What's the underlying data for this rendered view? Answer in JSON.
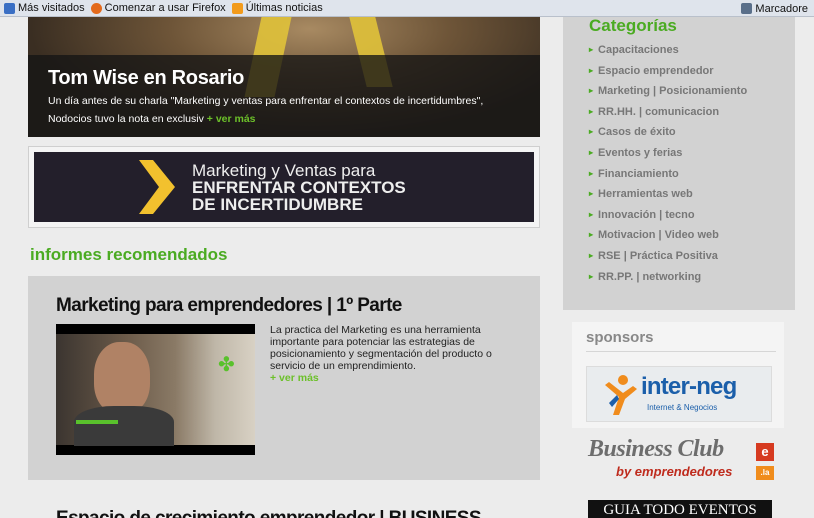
{
  "bookmarks": {
    "items": [
      {
        "label": "Más visitados",
        "icon": "most-visited-icon"
      },
      {
        "label": "Comenzar a usar Firefox",
        "icon": "firefox-icon"
      },
      {
        "label": "Últimas noticias",
        "icon": "rss-icon"
      }
    ],
    "right_label": "Marcadore"
  },
  "hero": {
    "title": "Tom Wise en Rosario",
    "text_line1": "Un día antes de su charla \"Marketing y ventas para enfrentar el contextos de incertidumbres\",",
    "text_line2": "Nodocios tuvo la nota en exclusiv",
    "more_link": "+ ver más"
  },
  "banner": {
    "line1": "Marketing y Ventas para",
    "line2": "ENFRENTAR CONTEXTOS",
    "line3": "DE INCERTIDUMBRE"
  },
  "informes": {
    "section_title": "informes recomendados",
    "article1": {
      "title": "Marketing para emprendedores | 1º Parte",
      "text": "La practica del Marketing es una herramienta importante para potenciar las estrategias de posicionamiento y segmentación del producto o servicio de un emprendimiento.",
      "more_link": "+ ver más"
    },
    "article2": {
      "title": "Espacio de crecimiento emprendedor | BUSINESS"
    }
  },
  "sidebar": {
    "categories_title": "Categorías",
    "categories": [
      "Capacitaciones",
      "Espacio emprendedor",
      "Marketing | Posicionamiento",
      "RR.HH. | comunicacion",
      "Casos de éxito",
      "Eventos y ferias",
      "Financiamiento",
      "Herramientas web",
      "Innovación | tecno",
      "Motivacion | Video web",
      "RSE | Práctica Positiva",
      "RR.PP. | networking"
    ],
    "sponsors_title": "sponsors",
    "interneg": {
      "name": "inter-neg",
      "tagline": "Internet & Negocios"
    },
    "business_club": {
      "line1": "Business Club",
      "line2": "by emprendedores",
      "badge_e": "e",
      "badge_la": ".la"
    },
    "guia": "GUIA TODO EVENTOS"
  },
  "colors": {
    "accent_green": "#4bab22",
    "link_green": "#6cc02a",
    "interneg_blue": "#1b5faa"
  }
}
